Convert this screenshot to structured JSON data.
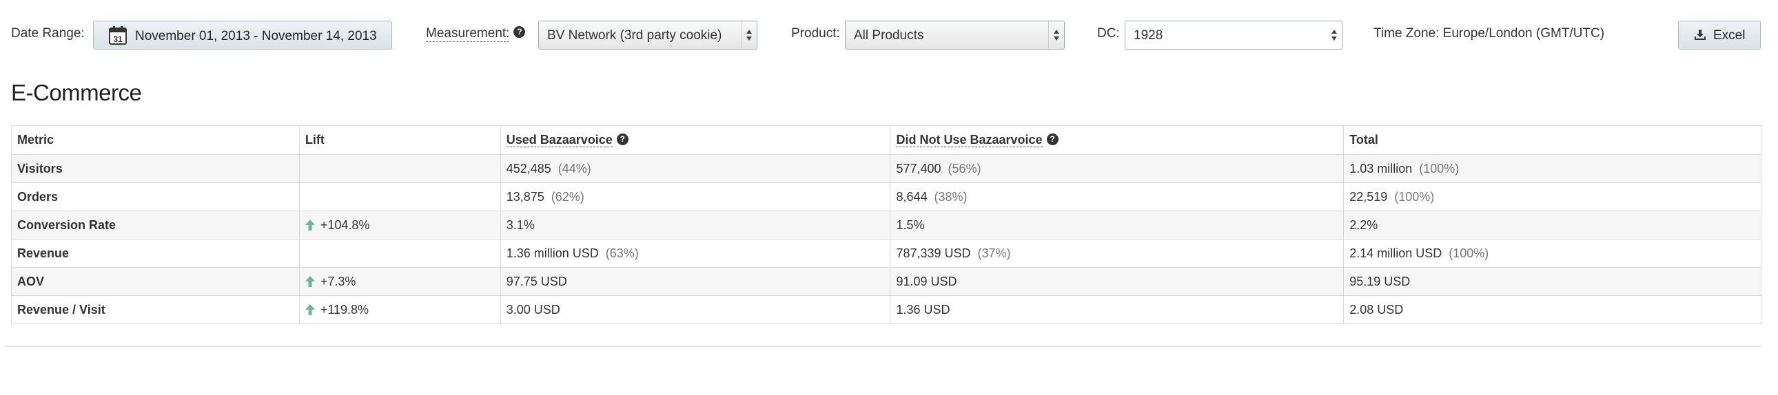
{
  "filters": {
    "date_range_label": "Date Range:",
    "date_range_value": "November 01, 2013 - November 14, 2013",
    "calendar_day": "31",
    "measurement_label": "Measurement:",
    "measurement_value": "BV Network (3rd party cookie)",
    "product_label": "Product:",
    "product_value": "All Products",
    "dc_label": "DC:",
    "dc_value": "1928",
    "timezone": "Time Zone: Europe/London (GMT/UTC)",
    "excel_label": "Excel"
  },
  "section": {
    "title": "E-Commerce"
  },
  "table": {
    "headers": {
      "metric": "Metric",
      "lift": "Lift",
      "used": "Used Bazaarvoice",
      "not_used": "Did Not Use Bazaarvoice",
      "total": "Total"
    },
    "rows": [
      {
        "metric": "Visitors",
        "lift": "",
        "used": "452,485",
        "used_pct": "(44%)",
        "not_used": "577,400",
        "not_used_pct": "(56%)",
        "total": "1.03 million",
        "total_pct": "(100%)"
      },
      {
        "metric": "Orders",
        "lift": "",
        "used": "13,875",
        "used_pct": "(62%)",
        "not_used": "8,644",
        "not_used_pct": "(38%)",
        "total": "22,519",
        "total_pct": "(100%)"
      },
      {
        "metric": "Conversion Rate",
        "lift": "+104.8%",
        "used": "3.1%",
        "used_pct": "",
        "not_used": "1.5%",
        "not_used_pct": "",
        "total": "2.2%",
        "total_pct": ""
      },
      {
        "metric": "Revenue",
        "lift": "",
        "used": "1.36 million USD",
        "used_pct": "(63%)",
        "not_used": "787,339 USD",
        "not_used_pct": "(37%)",
        "total": "2.14 million USD",
        "total_pct": "(100%)"
      },
      {
        "metric": "AOV",
        "lift": "+7.3%",
        "used": "97.75 USD",
        "used_pct": "",
        "not_used": "91.09 USD",
        "not_used_pct": "",
        "total": "95.19 USD",
        "total_pct": ""
      },
      {
        "metric": "Revenue / Visit",
        "lift": "+119.8%",
        "used": "3.00 USD",
        "used_pct": "",
        "not_used": "1.36 USD",
        "not_used_pct": "",
        "total": "2.08 USD",
        "total_pct": ""
      }
    ]
  },
  "icons": {
    "calendar": "calendar-icon",
    "help": "help-icon",
    "select_arrows": "select-arrows-icon",
    "download": "download-icon",
    "lift_up": "arrow-up-icon"
  },
  "colors": {
    "lift_arrow": "#6fb59b",
    "button_bg_top": "#eef3f6",
    "button_bg_bottom": "#d9e3e8",
    "row_stripe": "#f6f6f6",
    "border": "#dadada"
  }
}
